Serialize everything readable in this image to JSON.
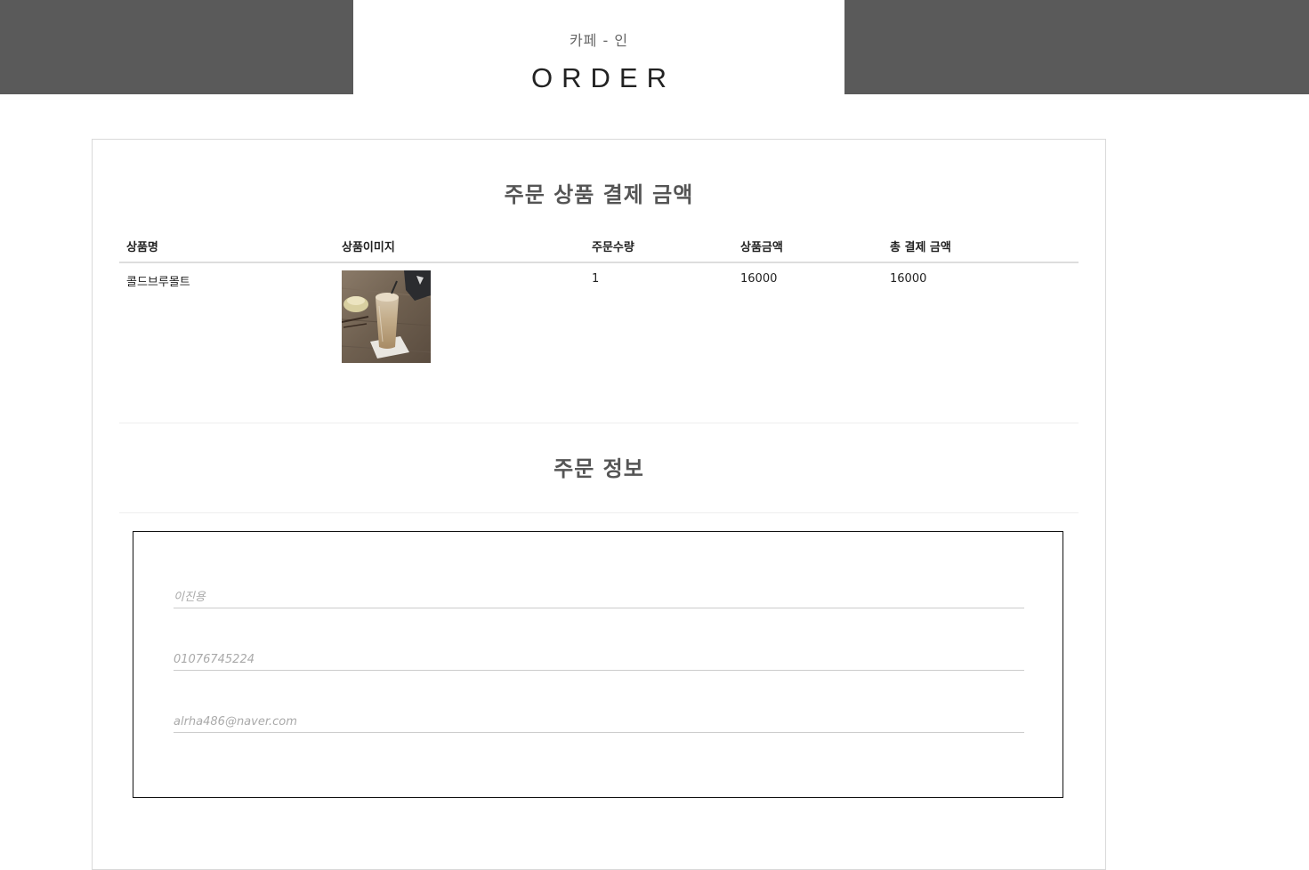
{
  "header": {
    "subtitle": "카페 - 인",
    "title": "ORDER",
    "bar_color": "#5a5a5a"
  },
  "order_section": {
    "title": "주문 상품 결제 금액",
    "columns": [
      "상품명",
      "상품이미지",
      "주문수량",
      "상품금액",
      "총 결제 금액"
    ],
    "rows": [
      {
        "name": "콜드브루몰트",
        "image": "iced-blended-coffee-drink-photo",
        "quantity": "1",
        "price": "16000",
        "total": "16000"
      }
    ]
  },
  "info_section": {
    "title": "주문 정보",
    "fields": [
      {
        "name": "name",
        "placeholder": "이진용"
      },
      {
        "name": "phone",
        "placeholder": "01076745224"
      },
      {
        "name": "email",
        "placeholder": "alrha486@naver.com"
      }
    ]
  }
}
